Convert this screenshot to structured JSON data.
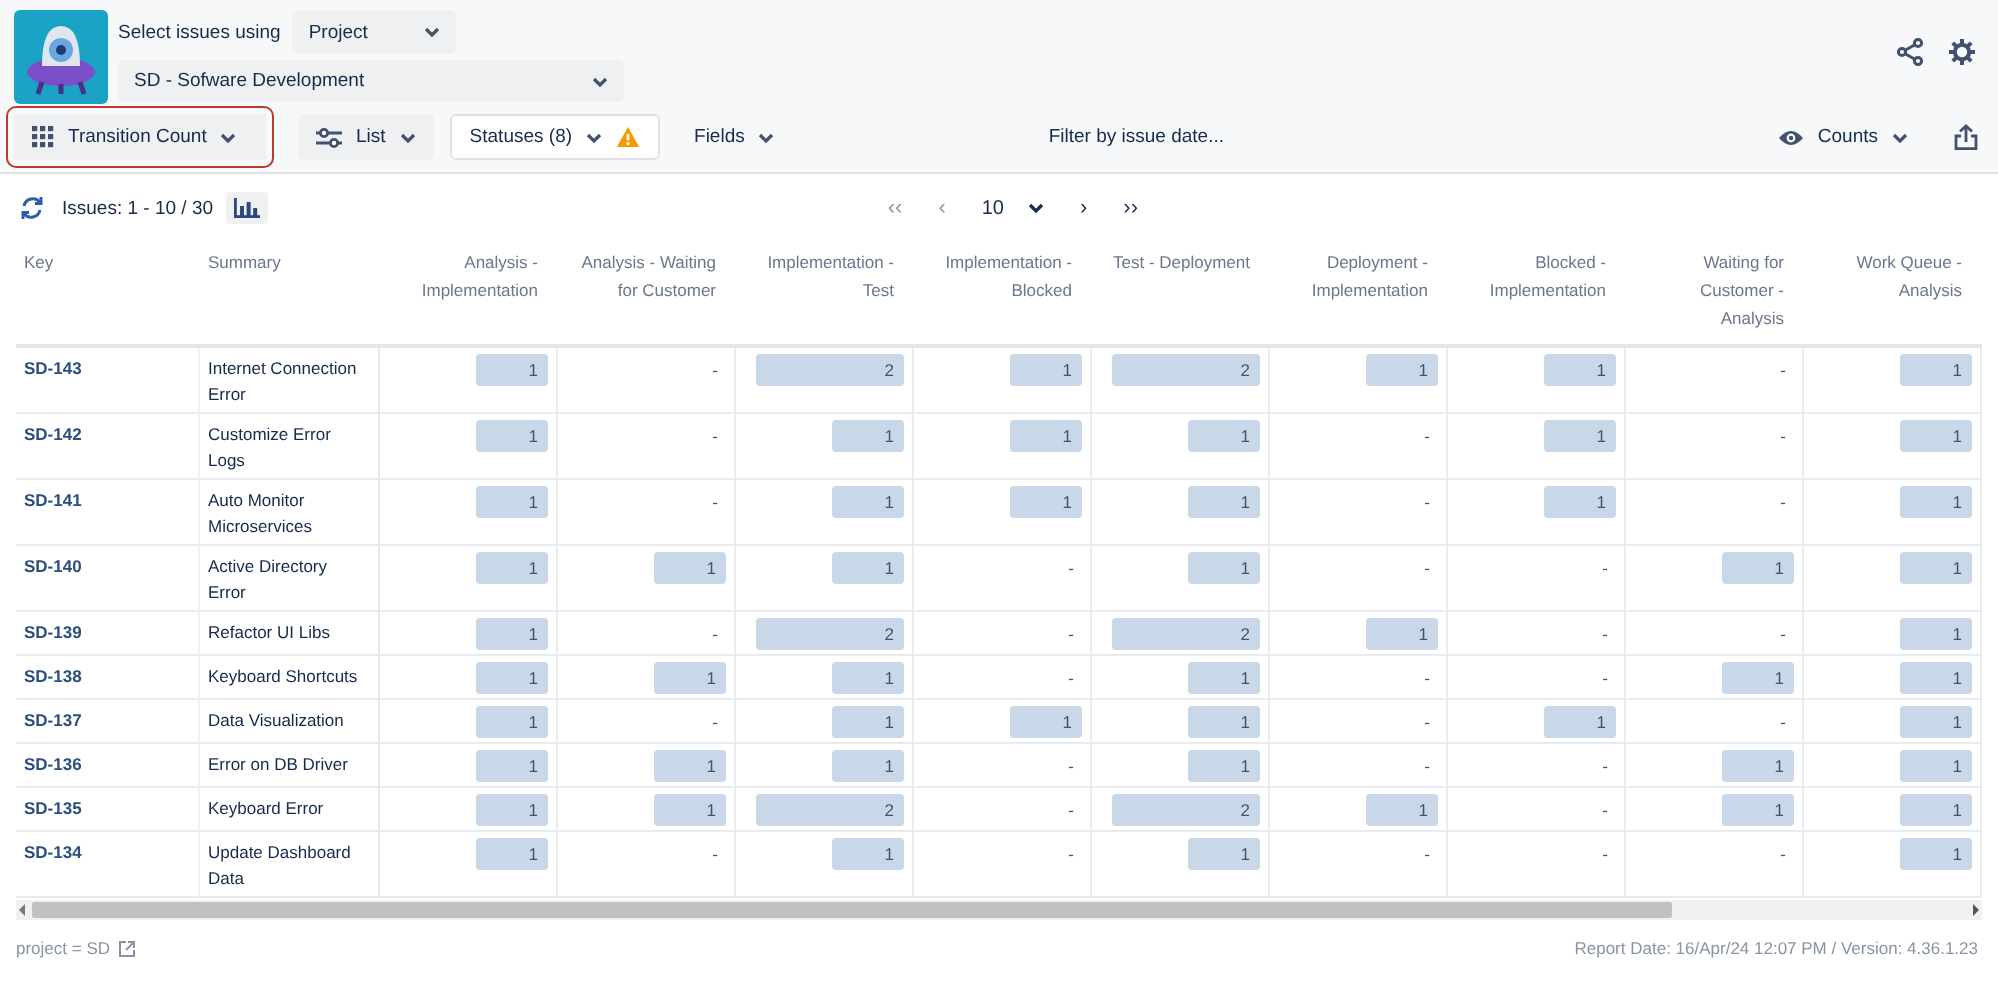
{
  "header": {
    "select_label": "Select issues using",
    "source_select": "Project",
    "project_select": "SD - Sofware Development"
  },
  "toolbar": {
    "report_type": {
      "label": "Transition Count",
      "highlighted": true
    },
    "list": "List",
    "statuses": "Statuses (8)",
    "fields": "Fields",
    "date_filter": "Filter by issue date...",
    "counts": "Counts"
  },
  "pager": {
    "issues": "Issues: 1 - 10 / 30",
    "first": "‹‹",
    "prev": "‹",
    "page_size": "10",
    "next": "›",
    "last": "››"
  },
  "table": {
    "columns": [
      "Key",
      "Summary",
      "Analysis - Implementation",
      "Analysis - Waiting for Customer",
      "Implementation - Test",
      "Implementation - Blocked",
      "Test - Deployment",
      "Deployment - Implementation",
      "Blocked - Implementation",
      "Waiting for Customer - Analysis",
      "Work Queue - Analysis"
    ],
    "rows": [
      {
        "cells": [
          {
            "value": "SD-143"
          },
          {
            "value": "Internet Connection Error"
          },
          {
            "value": "1",
            "level": 0.45
          },
          {
            "value": "-"
          },
          {
            "value": "2",
            "level": 0.92
          },
          {
            "value": "1",
            "level": 0.45
          },
          {
            "value": "2",
            "level": 0.92
          },
          {
            "value": "1",
            "level": 0.45
          },
          {
            "value": "1",
            "level": 0.45
          },
          {
            "value": "-"
          },
          {
            "value": "1",
            "level": 0.45
          }
        ]
      },
      {
        "cells": [
          {
            "value": "SD-142"
          },
          {
            "value": "Customize Error Logs"
          },
          {
            "value": "1",
            "level": 0.45
          },
          {
            "value": "-"
          },
          {
            "value": "1",
            "level": 0.45
          },
          {
            "value": "1",
            "level": 0.45
          },
          {
            "value": "1",
            "level": 0.45
          },
          {
            "value": "-"
          },
          {
            "value": "1",
            "level": 0.45
          },
          {
            "value": "-"
          },
          {
            "value": "1",
            "level": 0.45
          }
        ]
      },
      {
        "cells": [
          {
            "value": "SD-141"
          },
          {
            "value": "Auto Monitor Microservices"
          },
          {
            "value": "1",
            "level": 0.45
          },
          {
            "value": "-"
          },
          {
            "value": "1",
            "level": 0.45
          },
          {
            "value": "1",
            "level": 0.45
          },
          {
            "value": "1",
            "level": 0.45
          },
          {
            "value": "-"
          },
          {
            "value": "1",
            "level": 0.45
          },
          {
            "value": "-"
          },
          {
            "value": "1",
            "level": 0.45
          }
        ]
      },
      {
        "cells": [
          {
            "value": "SD-140"
          },
          {
            "value": "Active Directory Error"
          },
          {
            "value": "1",
            "level": 0.45
          },
          {
            "value": "1",
            "level": 0.45
          },
          {
            "value": "1",
            "level": 0.45
          },
          {
            "value": "-"
          },
          {
            "value": "1",
            "level": 0.45
          },
          {
            "value": "-"
          },
          {
            "value": "-"
          },
          {
            "value": "1",
            "level": 0.45
          },
          {
            "value": "1",
            "level": 0.45
          }
        ]
      },
      {
        "cells": [
          {
            "value": "SD-139"
          },
          {
            "value": "Refactor UI Libs"
          },
          {
            "value": "1",
            "level": 0.45
          },
          {
            "value": "-"
          },
          {
            "value": "2",
            "level": 0.92
          },
          {
            "value": "-"
          },
          {
            "value": "2",
            "level": 0.92
          },
          {
            "value": "1",
            "level": 0.45
          },
          {
            "value": "-"
          },
          {
            "value": "-"
          },
          {
            "value": "1",
            "level": 0.45
          }
        ]
      },
      {
        "cells": [
          {
            "value": "SD-138"
          },
          {
            "value": "Keyboard Shortcuts"
          },
          {
            "value": "1",
            "level": 0.45
          },
          {
            "value": "1",
            "level": 0.45
          },
          {
            "value": "1",
            "level": 0.45
          },
          {
            "value": "-"
          },
          {
            "value": "1",
            "level": 0.45
          },
          {
            "value": "-"
          },
          {
            "value": "-"
          },
          {
            "value": "1",
            "level": 0.45
          },
          {
            "value": "1",
            "level": 0.45
          }
        ]
      },
      {
        "cells": [
          {
            "value": "SD-137"
          },
          {
            "value": "Data Visualization"
          },
          {
            "value": "1",
            "level": 0.45
          },
          {
            "value": "-"
          },
          {
            "value": "1",
            "level": 0.45
          },
          {
            "value": "1",
            "level": 0.45
          },
          {
            "value": "1",
            "level": 0.45
          },
          {
            "value": "-"
          },
          {
            "value": "1",
            "level": 0.45
          },
          {
            "value": "-"
          },
          {
            "value": "1",
            "level": 0.45
          }
        ]
      },
      {
        "cells": [
          {
            "value": "SD-136"
          },
          {
            "value": "Error on DB Driver"
          },
          {
            "value": "1",
            "level": 0.45
          },
          {
            "value": "1",
            "level": 0.45
          },
          {
            "value": "1",
            "level": 0.45
          },
          {
            "value": "-"
          },
          {
            "value": "1",
            "level": 0.45
          },
          {
            "value": "-"
          },
          {
            "value": "-"
          },
          {
            "value": "1",
            "level": 0.45
          },
          {
            "value": "1",
            "level": 0.45
          }
        ]
      },
      {
        "cells": [
          {
            "value": "SD-135"
          },
          {
            "value": "Keyboard Error"
          },
          {
            "value": "1",
            "level": 0.45
          },
          {
            "value": "1",
            "level": 0.45
          },
          {
            "value": "2",
            "level": 0.92
          },
          {
            "value": "-"
          },
          {
            "value": "2",
            "level": 0.92
          },
          {
            "value": "1",
            "level": 0.45
          },
          {
            "value": "-"
          },
          {
            "value": "1",
            "level": 0.45
          },
          {
            "value": "1",
            "level": 0.45
          }
        ]
      },
      {
        "cells": [
          {
            "value": "SD-134"
          },
          {
            "value": "Update Dashboard Data"
          },
          {
            "value": "1",
            "level": 0.45
          },
          {
            "value": "-"
          },
          {
            "value": "1",
            "level": 0.45
          },
          {
            "value": "-"
          },
          {
            "value": "1",
            "level": 0.45
          },
          {
            "value": "-"
          },
          {
            "value": "-"
          },
          {
            "value": "-"
          },
          {
            "value": "1",
            "level": 0.45
          }
        ]
      }
    ]
  },
  "footer": {
    "jql": "project = SD",
    "report_info": "Report Date: 16/Apr/24 12:07 PM / Version: 4.36.1.23"
  }
}
